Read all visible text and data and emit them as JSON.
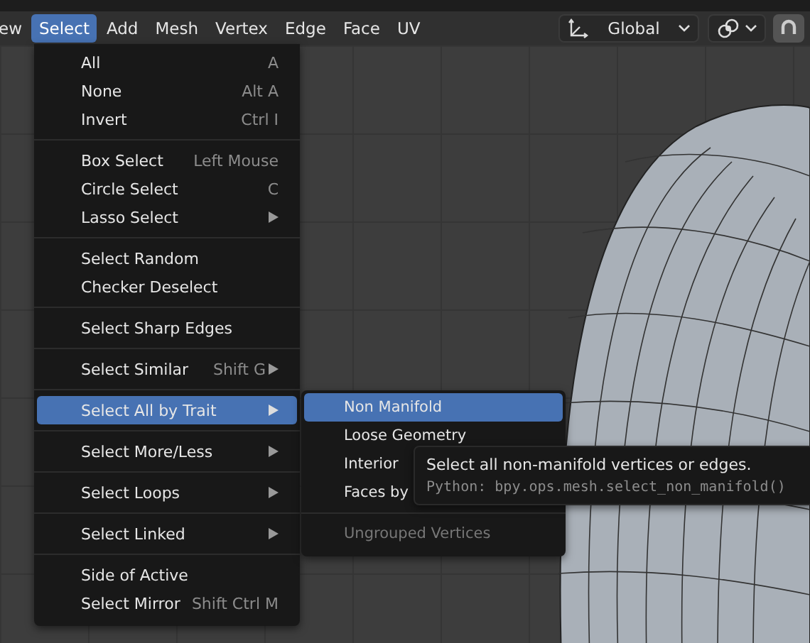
{
  "header": {
    "cut_label": "ew",
    "menus": [
      {
        "label": "Select",
        "selected": true
      },
      {
        "label": "Add",
        "selected": false
      },
      {
        "label": "Mesh",
        "selected": false
      },
      {
        "label": "Vertex",
        "selected": false
      },
      {
        "label": "Edge",
        "selected": false
      },
      {
        "label": "Face",
        "selected": false
      },
      {
        "label": "UV",
        "selected": false
      }
    ],
    "orientation": {
      "value": "Global"
    }
  },
  "select_menu": {
    "sections": [
      [
        {
          "label": "All",
          "shortcut": "A",
          "submenu": false,
          "selected": false
        },
        {
          "label": "None",
          "shortcut": "Alt A",
          "submenu": false,
          "selected": false
        },
        {
          "label": "Invert",
          "shortcut": "Ctrl I",
          "submenu": false,
          "selected": false
        }
      ],
      [
        {
          "label": "Box Select",
          "shortcut": "Left Mouse",
          "submenu": false,
          "selected": false
        },
        {
          "label": "Circle Select",
          "shortcut": "C",
          "submenu": false,
          "selected": false
        },
        {
          "label": "Lasso Select",
          "submenu": true,
          "selected": false
        }
      ],
      [
        {
          "label": "Select Random",
          "submenu": false,
          "selected": false
        },
        {
          "label": "Checker Deselect",
          "submenu": false,
          "selected": false
        }
      ],
      [
        {
          "label": "Select Sharp Edges",
          "submenu": false,
          "selected": false
        }
      ],
      [
        {
          "label": "Select Similar",
          "shortcut": "Shift G",
          "submenu": true,
          "selected": false
        }
      ],
      [
        {
          "label": "Select All by Trait",
          "submenu": true,
          "selected": true
        }
      ],
      [
        {
          "label": "Select More/Less",
          "submenu": true,
          "selected": false
        }
      ],
      [
        {
          "label": "Select Loops",
          "submenu": true,
          "selected": false
        }
      ],
      [
        {
          "label": "Select Linked",
          "submenu": true,
          "selected": false
        }
      ],
      [
        {
          "label": "Side of Active",
          "submenu": false,
          "selected": false
        },
        {
          "label": "Select Mirror",
          "shortcut": "Shift Ctrl M",
          "submenu": false,
          "selected": false
        }
      ]
    ]
  },
  "trait_submenu": {
    "sections": [
      [
        {
          "label": "Non Manifold",
          "selected": true,
          "disabled": false
        },
        {
          "label": "Loose Geometry",
          "selected": false,
          "disabled": false
        },
        {
          "label": "Interior",
          "selected": false,
          "disabled": false
        },
        {
          "label": "Faces by",
          "selected": false,
          "disabled": false
        }
      ],
      [
        {
          "label": "Ungrouped Vertices",
          "selected": false,
          "disabled": true
        }
      ]
    ]
  },
  "tooltip": {
    "description": "Select all non-manifold vertices or edges.",
    "python": "Python: bpy.ops.mesh.select_non_manifold()"
  }
}
